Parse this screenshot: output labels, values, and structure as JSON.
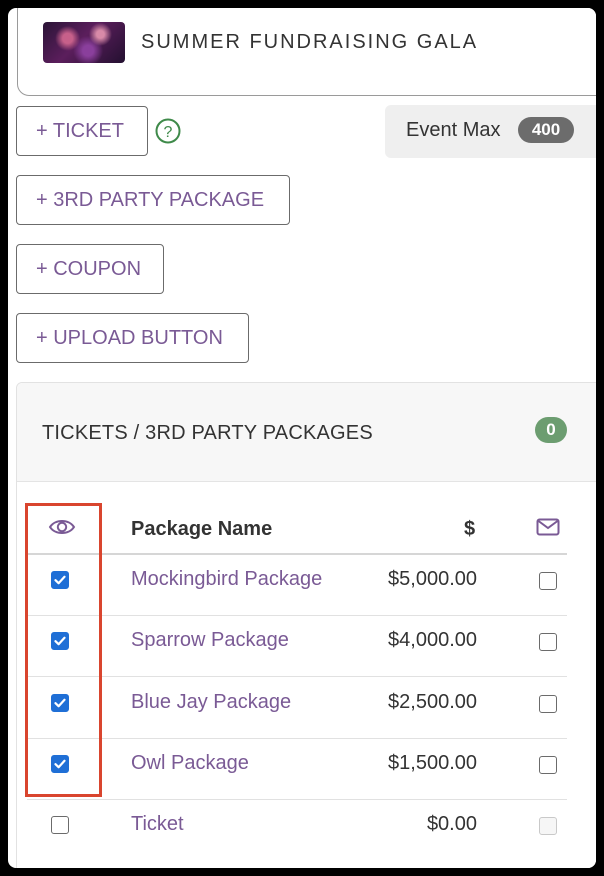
{
  "event": {
    "title": "SUMMER FUNDRAISING GALA",
    "thumbnail": "event-photo"
  },
  "actions": {
    "add_ticket": "+ TICKET",
    "add_3rd_party": "+ 3RD PARTY PACKAGE",
    "add_coupon": "+ COUPON",
    "upload_button": "+ UPLOAD BUTTON",
    "help_icon": "?"
  },
  "event_max": {
    "label": "Event Max",
    "count": "400"
  },
  "panel": {
    "title": "TICKETS / 3RD PARTY PACKAGES",
    "count": "0",
    "columns": {
      "visible_icon": "eye-icon",
      "name": "Package Name",
      "price": "$",
      "email_icon": "envelope-icon"
    },
    "rows": [
      {
        "visible": true,
        "name": "Mockingbird Package",
        "price": "$5,000.00",
        "email": false,
        "email_disabled": false
      },
      {
        "visible": true,
        "name": "Sparrow Package",
        "price": "$4,000.00",
        "email": false,
        "email_disabled": false
      },
      {
        "visible": true,
        "name": "Blue Jay Package",
        "price": "$2,500.00",
        "email": false,
        "email_disabled": false
      },
      {
        "visible": true,
        "name": "Owl Package",
        "price": "$1,500.00",
        "email": false,
        "email_disabled": false
      },
      {
        "visible": false,
        "name": "Ticket",
        "price": "$0.00",
        "email": false,
        "email_disabled": true
      }
    ]
  },
  "colors": {
    "accent": "#7a5a95",
    "checkbox": "#1f6fd6",
    "highlight": "#d9452e",
    "badge_green": "#6c9d70",
    "badge_gray": "#6c6c6c"
  }
}
